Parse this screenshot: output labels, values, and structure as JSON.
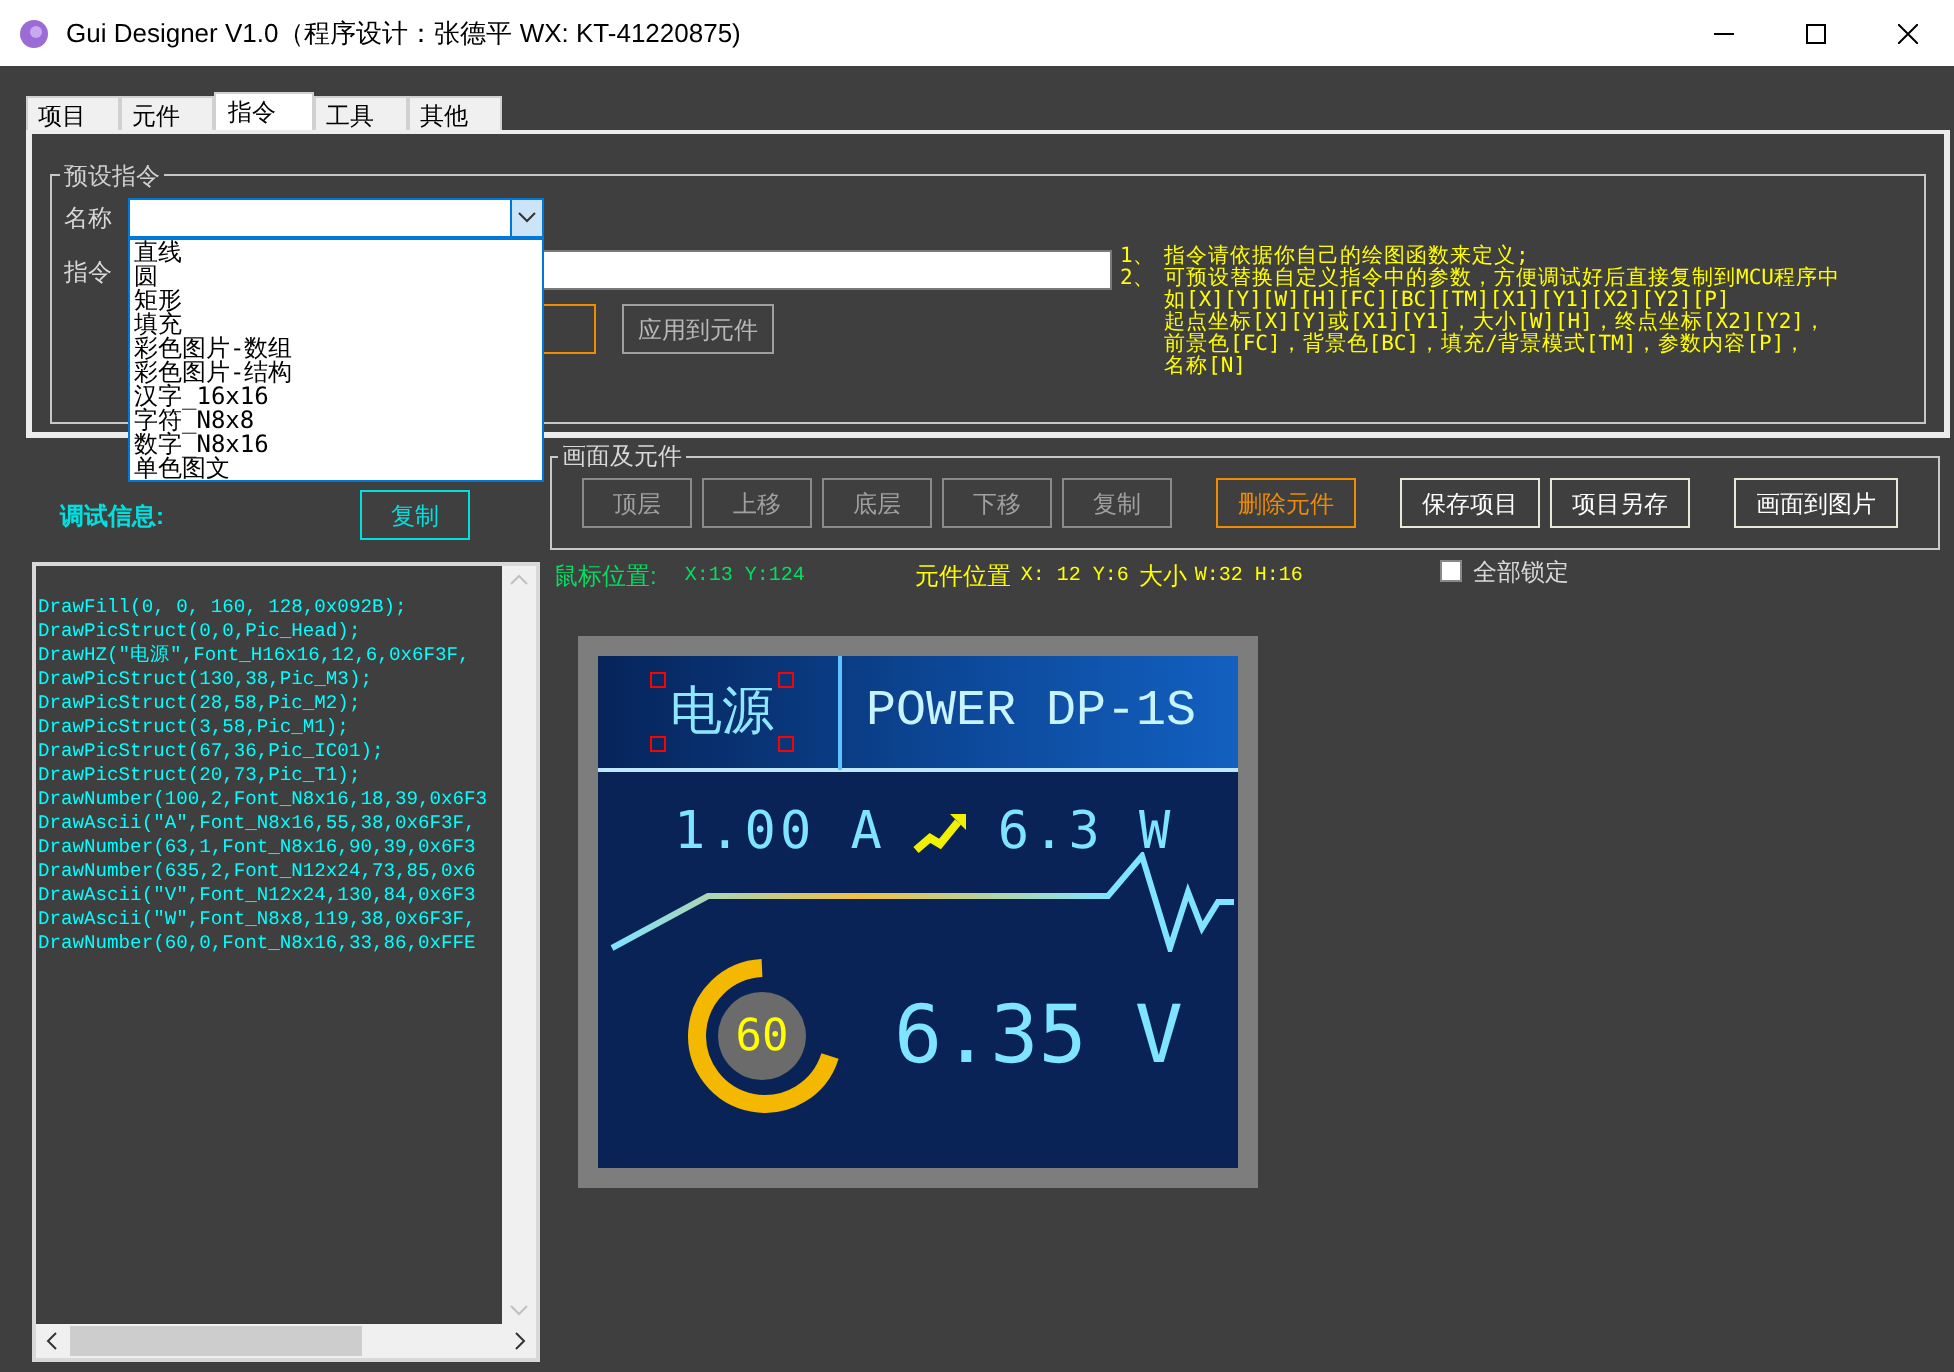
{
  "window": {
    "title": "Gui Designer V1.0（程序设计：张德平 WX: KT-41220875)"
  },
  "tabs": [
    {
      "label": "项目",
      "selected": false
    },
    {
      "label": "元件",
      "selected": false
    },
    {
      "label": "指令",
      "selected": true
    },
    {
      "label": "工具",
      "selected": false
    },
    {
      "label": "其他",
      "selected": false
    }
  ],
  "preset": {
    "legend": "预设指令",
    "name_label": "名称",
    "name_combo": {
      "expanded": true,
      "options": [
        "直线",
        "圆",
        "矩形",
        "填充",
        "彩色图片-数组",
        "彩色图片-结构",
        "汉字_16x16",
        "字符_N8x8",
        "数字_N8x16",
        "单色图文"
      ]
    },
    "command_label": "指令",
    "notes": [
      {
        "number": "1、",
        "lines": [
          "指令请依据你自己的绘图函数来定义;"
        ]
      },
      {
        "number": "2、",
        "lines": [
          "可预设替换自定义指令中的参数，方便调试好后直接复制到MCU程序中",
          "如[X][Y][W][H][FC][BC][TM][X1][Y1][X2][Y2][P]",
          "起点坐标[X][Y]或[X1][Y1]，大小[W][H]，终点坐标[X2][Y2]，",
          "前景色[FC]，背景色[BC]，填充/背景模式[TM]，参数内容[P]，",
          "名称[N]"
        ]
      }
    ],
    "apply_button": "应用到元件"
  },
  "debug": {
    "label": "调试信息:",
    "copy_button": "复制",
    "lines": [
      "DrawFill(0, 0, 160, 128,0x092B);",
      "DrawPicStruct(0,0,Pic_Head);",
      "DrawHZ(\"电源\",Font_H16x16,12,6,0x6F3F,",
      "DrawPicStruct(130,38,Pic_M3);",
      "DrawPicStruct(28,58,Pic_M2);",
      "DrawPicStruct(3,58,Pic_M1);",
      "DrawPicStruct(67,36,Pic_IC01);",
      "DrawPicStruct(20,73,Pic_T1);",
      "DrawNumber(100,2,Font_N8x16,18,39,0x6F3",
      "DrawAscii(\"A\",Font_N8x16,55,38,0x6F3F,",
      "DrawNumber(63,1,Font_N8x16,90,39,0x6F3",
      "DrawNumber(635,2,Font_N12x24,73,85,0x6",
      "DrawAscii(\"V\",Font_N12x24,130,84,0x6F3",
      "DrawAscii(\"W\",Font_N8x8,119,38,0x6F3F,",
      "DrawNumber(60,0,Font_N8x16,33,86,0xFFE"
    ]
  },
  "canvas_group": {
    "legend": "画面及元件",
    "button_groups": [
      [
        {
          "label": "顶层",
          "kind": "muted"
        },
        {
          "label": "上移",
          "kind": "muted"
        },
        {
          "label": "底层",
          "kind": "muted"
        },
        {
          "label": "下移",
          "kind": "muted"
        },
        {
          "label": "复制",
          "kind": "muted"
        }
      ],
      [
        {
          "label": "删除元件",
          "kind": "warning"
        }
      ],
      [
        {
          "label": "保存项目",
          "kind": "normal"
        },
        {
          "label": "项目另存",
          "kind": "normal"
        }
      ],
      [
        {
          "label": "画面到图片",
          "kind": "normal"
        }
      ]
    ]
  },
  "status": {
    "mouse_label": "鼠标位置:",
    "mouse_value": "X:13 Y:124",
    "element_label": "元件位置",
    "element_position": "X: 12 Y:6",
    "size_label": "大小",
    "size_value": "W:32 H:16"
  },
  "lock_all": {
    "label": "全部锁定",
    "checked": false
  },
  "lcd": {
    "title": "电源",
    "title_selected": true,
    "subtitle": "POWER DP-1S",
    "current": "1.00 A",
    "power": "6.3 W",
    "gauge_value": "60",
    "voltage": "6.35 V"
  }
}
